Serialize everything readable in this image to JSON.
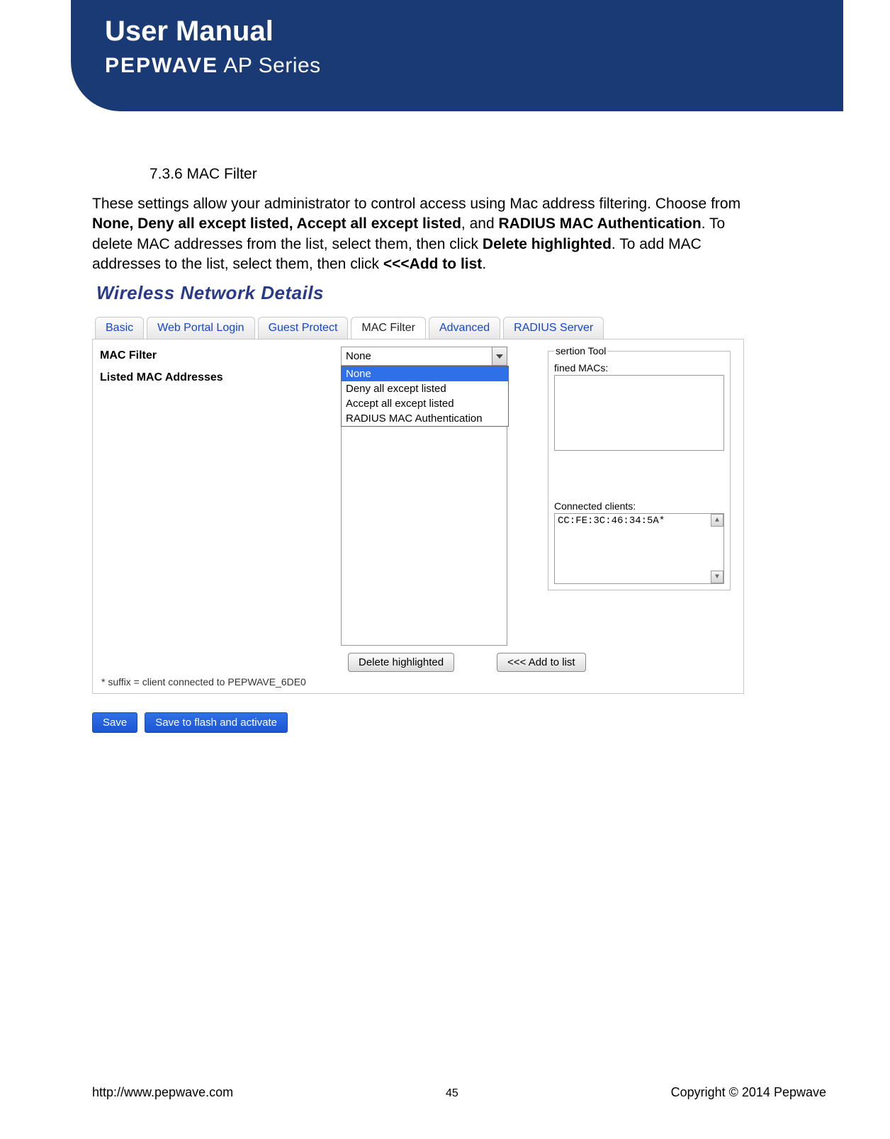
{
  "header": {
    "title": "User Manual",
    "brand_strong": "PEPWAVE",
    "brand_thin": " AP Series"
  },
  "section": {
    "heading": "7.3.6 MAC Filter",
    "para_plain_1": "These settings allow your administrator to control access using Mac address filtering. Choose from ",
    "para_bold_1": "None, Deny all except listed, Accept all except listed",
    "para_plain_2": ", and ",
    "para_bold_2": "RADIUS MAC Authentication",
    "para_plain_3": ". To delete MAC addresses from the list, select them, then click ",
    "para_bold_3": "Delete highlighted",
    "para_plain_4": ". To add MAC addresses to the list, select them, then click ",
    "para_bold_4": "<<<Add to list",
    "para_plain_5": "."
  },
  "screenshot": {
    "title": "Wireless Network Details",
    "tabs": {
      "basic": "Basic",
      "web_portal": "Web Portal Login",
      "guest_protect": "Guest Protect",
      "mac_filter": "MAC Filter",
      "advanced": "Advanced",
      "radius": "RADIUS Server"
    },
    "labels": {
      "mac_filter": "MAC Filter",
      "listed_macs": "Listed MAC Addresses"
    },
    "select": {
      "current": "None",
      "options": {
        "none": "None",
        "deny": "Deny all except listed",
        "accept": "Accept all except listed",
        "radius": "RADIUS MAC Authentication"
      }
    },
    "tool": {
      "legend_partial": "sertion Tool",
      "defined_partial": "fined MACs:",
      "connected_label": "Connected clients:",
      "client_entry": "CC:FE:3C:46:34:5A*"
    },
    "buttons": {
      "delete": "Delete highlighted",
      "add": "<<< Add to list",
      "save": "Save",
      "save_flash": "Save to flash and activate"
    },
    "footnote": "* suffix = client connected to PEPWAVE_6DE0"
  },
  "footer": {
    "url": "http://www.pepwave.com",
    "page_number": "45",
    "copyright_pre": "Copyright  ©  ",
    "copyright_year": "2014",
    "copyright_post": "  Pepwave"
  }
}
